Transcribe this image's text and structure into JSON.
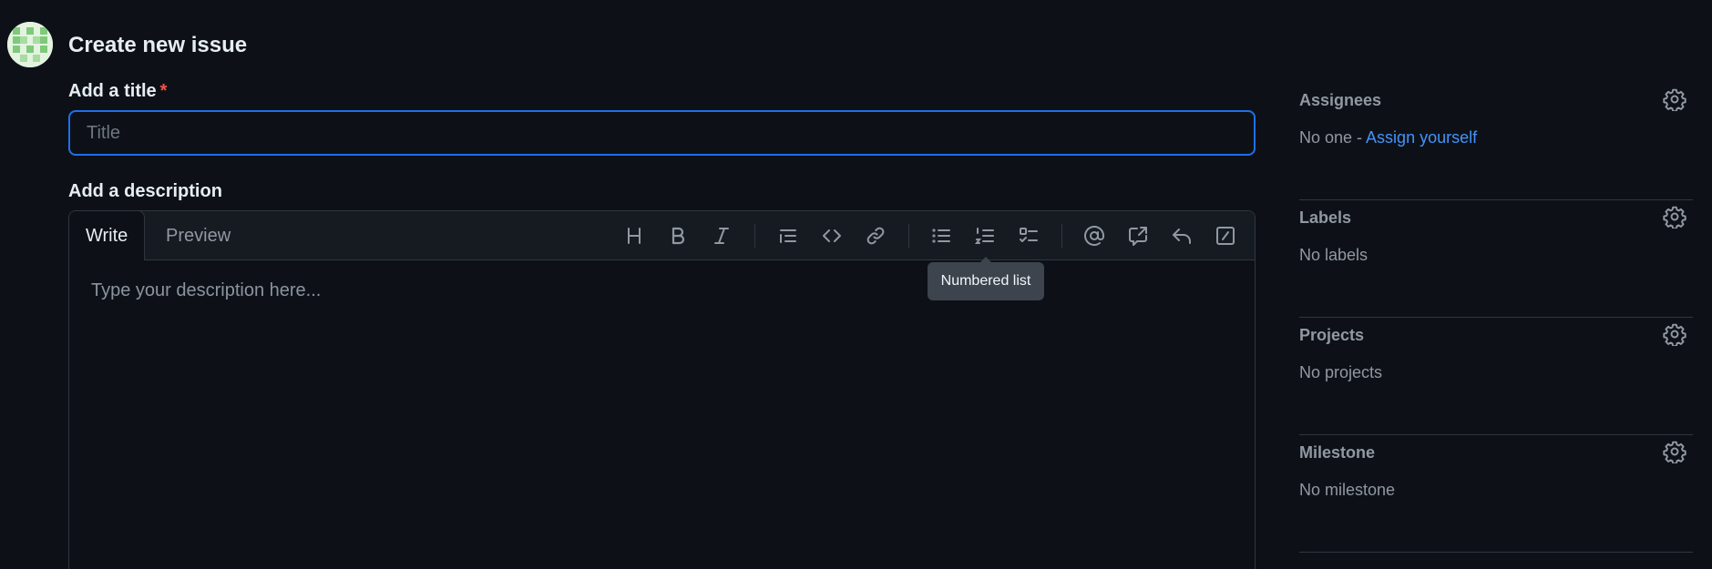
{
  "header": {
    "title": "Create new issue"
  },
  "title_field": {
    "label": "Add a title",
    "required_marker": "*",
    "placeholder": "Title",
    "value": ""
  },
  "description_field": {
    "label": "Add a description",
    "tabs": [
      {
        "label": "Write",
        "selected": true
      },
      {
        "label": "Preview",
        "selected": false
      }
    ],
    "placeholder": "Type your description here...",
    "value": "",
    "toolbar": [
      {
        "name": "heading",
        "icon": "heading-icon"
      },
      {
        "name": "bold",
        "icon": "bold-icon"
      },
      {
        "name": "italic",
        "icon": "italic-icon"
      },
      {
        "name": "quote",
        "icon": "quote-icon"
      },
      {
        "name": "code",
        "icon": "code-icon"
      },
      {
        "name": "link",
        "icon": "link-icon"
      },
      {
        "name": "unordered list",
        "icon": "unordered-list-icon"
      },
      {
        "name": "numbered list",
        "icon": "numbered-list-icon"
      },
      {
        "name": "task list",
        "icon": "task-list-icon"
      },
      {
        "name": "mention",
        "icon": "mention-icon"
      },
      {
        "name": "cross reference",
        "icon": "cross-reference-icon"
      },
      {
        "name": "saved replies",
        "icon": "reply-icon"
      },
      {
        "name": "slash commands",
        "icon": "slash-commands-icon"
      }
    ],
    "tooltip": "Numbered list"
  },
  "sidebar": {
    "assignees": {
      "heading": "Assignees",
      "value": "No one - ",
      "action": "Assign yourself"
    },
    "labels": {
      "heading": "Labels",
      "value": "No labels"
    },
    "projects": {
      "heading": "Projects",
      "value": "No projects"
    },
    "milestone": {
      "heading": "Milestone",
      "value": "No milestone"
    }
  },
  "colors": {
    "background": "#0d1117",
    "focus_border": "#1f6feb",
    "link": "#4493f8",
    "required": "#f85149",
    "muted_text": "#9198a1"
  }
}
